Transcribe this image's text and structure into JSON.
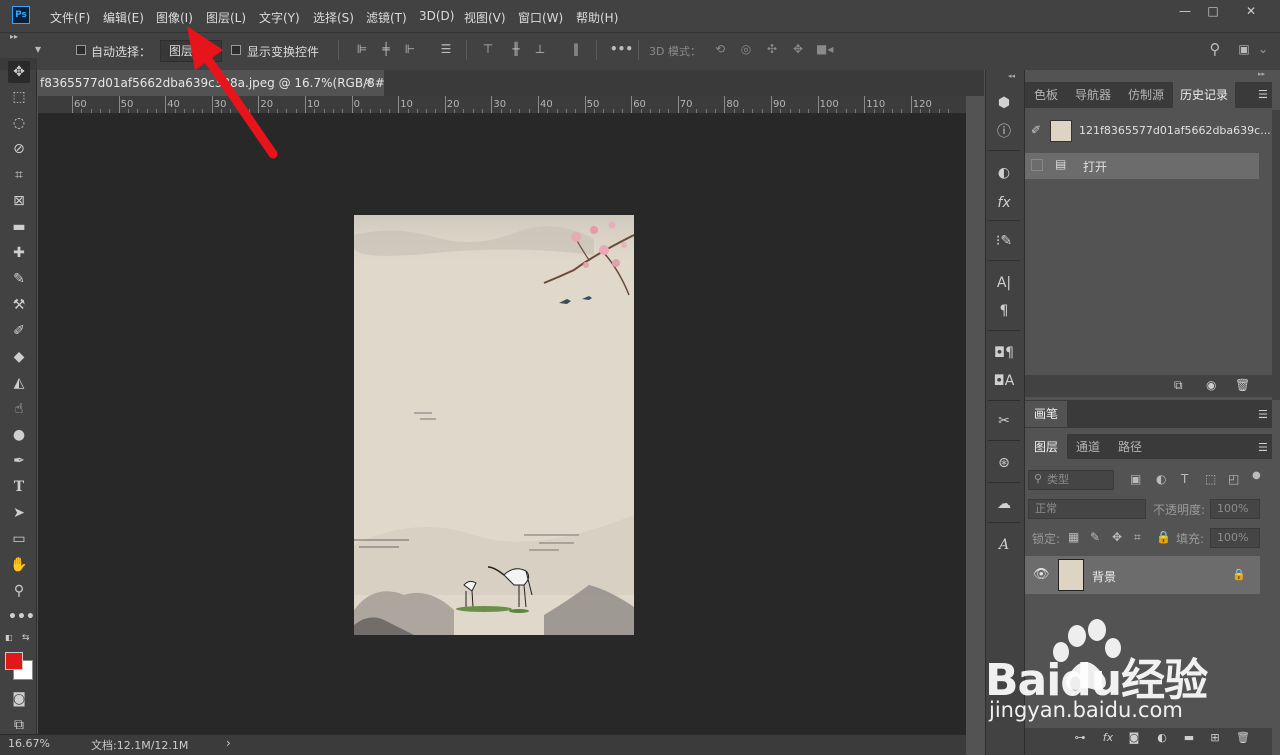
{
  "app": {
    "logo_text": "Ps"
  },
  "menubar": {
    "items": [
      "文件(F)",
      "编辑(E)",
      "图像(I)",
      "图层(L)",
      "文字(Y)",
      "选择(S)",
      "滤镜(T)",
      "3D(D)",
      "视图(V)",
      "窗口(W)",
      "帮助(H)"
    ],
    "window_buttons": [
      "—",
      "□",
      "✕"
    ]
  },
  "options_bar": {
    "auto_select_label": "自动选择：",
    "auto_select_dropdown_value": "图层",
    "show_transform_label": "显示变换控件",
    "mode_3d_label": "3D 模式："
  },
  "document": {
    "tab_title": "f8365577d01af5662dba639c388a.jpeg @ 16.7%(RGB/8#)",
    "tab_close": "×",
    "ruler_marks": [
      "60",
      "50",
      "40",
      "30",
      "20",
      "10",
      "0",
      "10",
      "20",
      "30",
      "40",
      "50",
      "60",
      "70",
      "80",
      "90",
      "100",
      "110",
      "120"
    ]
  },
  "status_bar": {
    "zoom": "16.67%",
    "doc_info": "文档:12.1M/12.1M",
    "arrow": "›"
  },
  "history_panel": {
    "tabs": [
      "色板",
      "导航器",
      "仿制源",
      "历史记录"
    ],
    "active_tab": "历史记录",
    "snapshot_name": "121f8365577d01af5662dba639c...",
    "items": [
      {
        "label": "打开"
      }
    ]
  },
  "brush_panel": {
    "title": "画笔"
  },
  "layers_panel": {
    "tabs": [
      "图层",
      "通道",
      "路径"
    ],
    "active_tab": "图层",
    "filter_placeholder": "类型",
    "blend_mode": "正常",
    "opacity_label": "不透明度:",
    "opacity_value": "100%",
    "lock_label": "锁定:",
    "fill_label": "填充:",
    "fill_value": "100%",
    "layers": [
      {
        "name": "背景",
        "visible": true,
        "locked": true
      }
    ]
  },
  "colors": {
    "foreground": "#e01818",
    "background": "#ffffff",
    "annotation_arrow": "#e8141b"
  },
  "watermark": {
    "text": "Baidu经验",
    "url": "jingyan.baidu.com"
  }
}
